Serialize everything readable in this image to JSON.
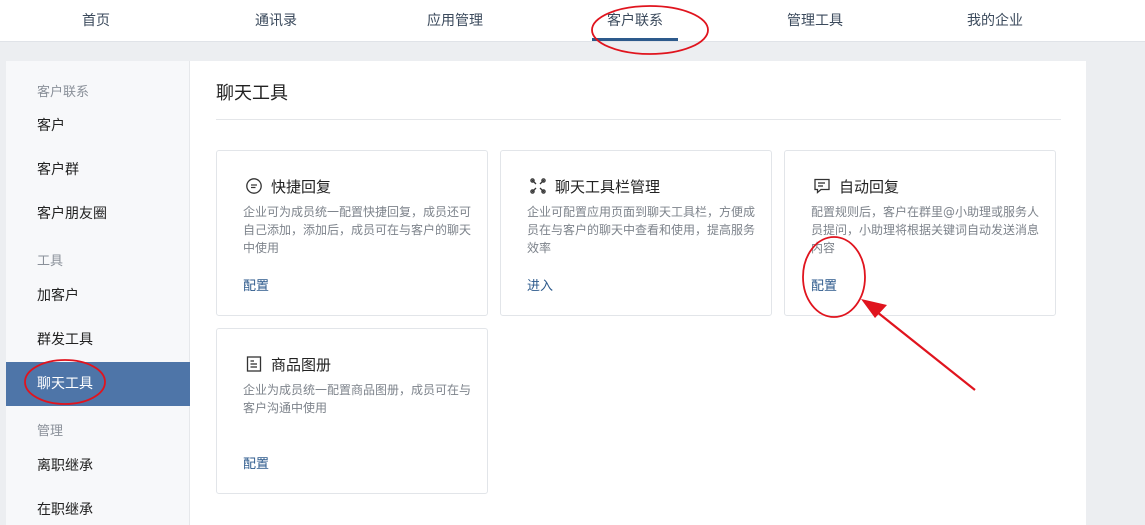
{
  "topnav": {
    "items": [
      {
        "label": "首页"
      },
      {
        "label": "通讯录"
      },
      {
        "label": "应用管理"
      },
      {
        "label": "客户联系"
      },
      {
        "label": "管理工具"
      },
      {
        "label": "我的企业"
      }
    ],
    "active_index": 3
  },
  "sidebar": {
    "groups": [
      {
        "label": "客户联系"
      },
      {
        "label": "工具"
      },
      {
        "label": "管理"
      }
    ],
    "items": [
      {
        "label": "客户"
      },
      {
        "label": "客户群"
      },
      {
        "label": "客户朋友圈"
      },
      {
        "label": "加客户"
      },
      {
        "label": "群发工具"
      },
      {
        "label": "聊天工具"
      },
      {
        "label": "离职继承"
      },
      {
        "label": "在职继承"
      }
    ],
    "active_label": "聊天工具"
  },
  "main": {
    "title": "聊天工具",
    "cards": [
      {
        "title": "快捷回复",
        "icon": "quick-reply-icon",
        "desc": "企业可为成员统一配置快捷回复，成员还可自己添加，添加后，成员可在与客户的聊天中使用",
        "link": "配置"
      },
      {
        "title": "聊天工具栏管理",
        "icon": "toolbar-icon",
        "desc": "企业可配置应用页面到聊天工具栏，方便成员在与客户的聊天中查看和使用，提高服务效率",
        "link": "进入"
      },
      {
        "title": "自动回复",
        "icon": "auto-reply-icon",
        "desc": "配置规则后，客户在群里@小助理或服务人员提问，小助理将根据关键词自动发送消息内容",
        "link": "配置"
      },
      {
        "title": "商品图册",
        "icon": "product-album-icon",
        "desc": "企业为成员统一配置商品图册，成员可在与客户沟通中使用",
        "link": "配置"
      }
    ]
  },
  "colors": {
    "accent": "#2d5a8c",
    "sidebar_active": "#4e75a8",
    "annotation": "#e0141e"
  }
}
